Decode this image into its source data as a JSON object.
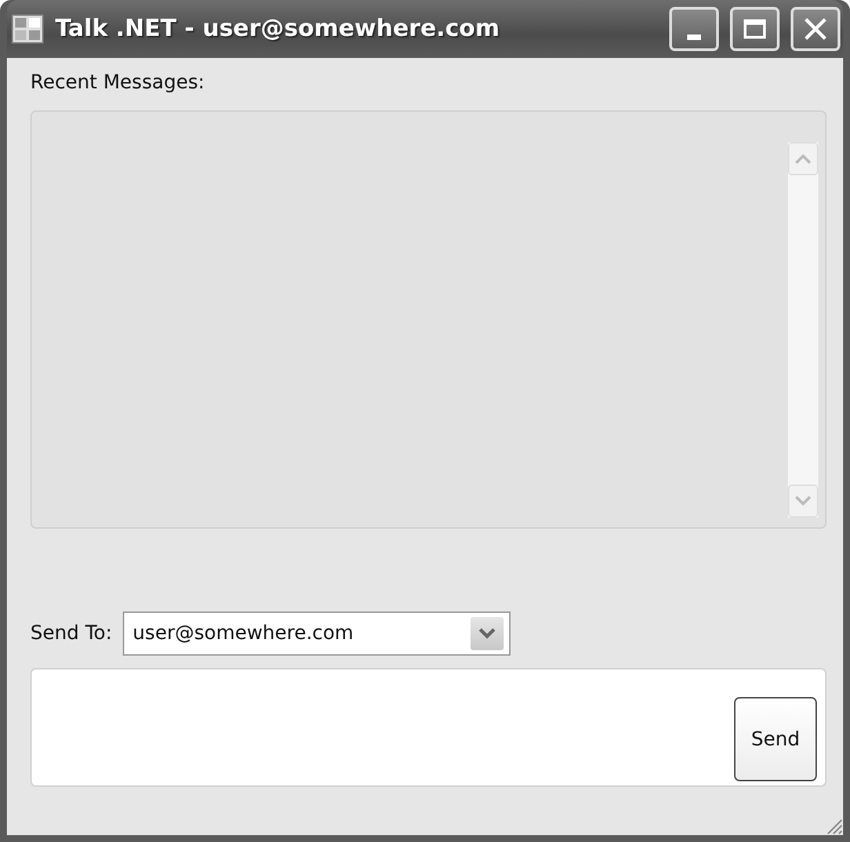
{
  "window": {
    "title": "Talk .NET - user@somewhere.com"
  },
  "recent_messages": {
    "label": "Recent Messages:",
    "disabled": true
  },
  "send_to": {
    "label": "Send To:",
    "value": "user@somewhere.com"
  },
  "message": {
    "send_button": "Send"
  }
}
